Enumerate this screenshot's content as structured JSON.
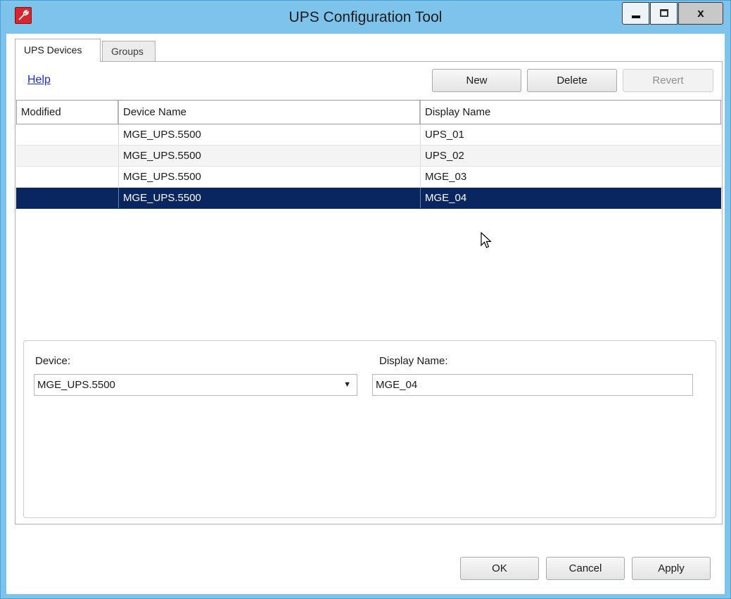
{
  "window": {
    "title": "UPS Configuration Tool",
    "close_glyph": "x",
    "icon": "wrench-icon"
  },
  "tabs": [
    {
      "label": "UPS Devices",
      "active": true
    },
    {
      "label": "Groups",
      "active": false
    }
  ],
  "toolbar": {
    "help_label": "Help",
    "new_label": "New",
    "delete_label": "Delete",
    "revert_label": "Revert"
  },
  "grid": {
    "columns": [
      "Modified",
      "Device Name",
      "Display Name"
    ],
    "rows": [
      {
        "modified": "",
        "device_name": "MGE_UPS.5500",
        "display_name": "UPS_01",
        "selected": false
      },
      {
        "modified": "",
        "device_name": "MGE_UPS.5500",
        "display_name": "UPS_02",
        "selected": false
      },
      {
        "modified": "",
        "device_name": "MGE_UPS.5500",
        "display_name": "MGE_03",
        "selected": false
      },
      {
        "modified": "",
        "device_name": "MGE_UPS.5500",
        "display_name": "MGE_04",
        "selected": true
      }
    ]
  },
  "details": {
    "device_label": "Device:",
    "device_value": "MGE_UPS.5500",
    "display_name_label": "Display Name:",
    "display_name_value": "MGE_04"
  },
  "footer": {
    "ok_label": "OK",
    "cancel_label": "Cancel",
    "apply_label": "Apply"
  },
  "colors": {
    "titlebar": "#7ec3ec",
    "selection": "#0a2660",
    "link": "#1a2fc7",
    "app_icon": "#d8262e"
  }
}
